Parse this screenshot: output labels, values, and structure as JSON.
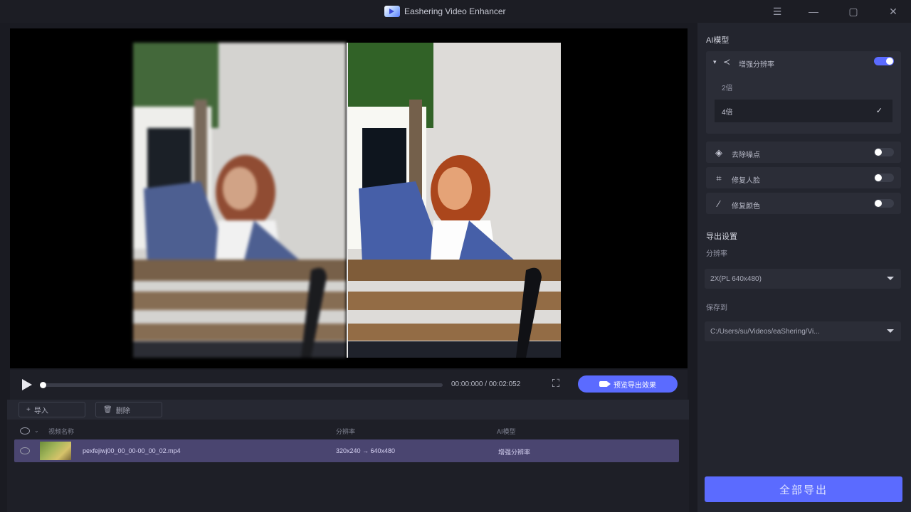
{
  "app": {
    "title": "Eashering Video Enhancer"
  },
  "window_controls": {
    "menu": "☰",
    "minimize": "—",
    "maximize": "▢",
    "close": "✕"
  },
  "player": {
    "time": "00:00:000 / 00:02:052",
    "preview_button": "预览导出效果",
    "progress_percent": 0
  },
  "list_toolbar": {
    "import_label": "导入",
    "delete_label": "删除"
  },
  "list": {
    "headers": {
      "name": "视频名称",
      "resolution": "分辨率",
      "ai_model": "AI模型"
    },
    "rows": [
      {
        "name": "pexfejiwj00_00_00-00_00_02.mp4",
        "resolution": "320x240 → 640x480",
        "model": "增强分辨率"
      }
    ]
  },
  "sidebar": {
    "ai_section_title": "AI模型",
    "main_feature": {
      "label": "增强分辨率",
      "enabled": true
    },
    "options": [
      {
        "label": "2倍",
        "selected": false
      },
      {
        "label": "4倍",
        "selected": true
      }
    ],
    "features": [
      {
        "icon": "layers-icon",
        "label": "去除噪点",
        "enabled": false
      },
      {
        "icon": "face-icon",
        "label": "修复人脸",
        "enabled": false
      },
      {
        "icon": "palette-icon",
        "label": "修复颜色",
        "enabled": false
      }
    ],
    "export_section_title": "导出设置",
    "resolution_label": "分辨率",
    "resolution_value": "2X(PL 640x480)",
    "save_path_label": "保存到",
    "save_path_value": "C:/Users/su/Videos/eaShering/Vi...",
    "export_all_button": "全部导出"
  },
  "colors": {
    "accent": "#5b6bff",
    "selected_row": "#4a4570",
    "sidebar_bg": "#23252e"
  }
}
